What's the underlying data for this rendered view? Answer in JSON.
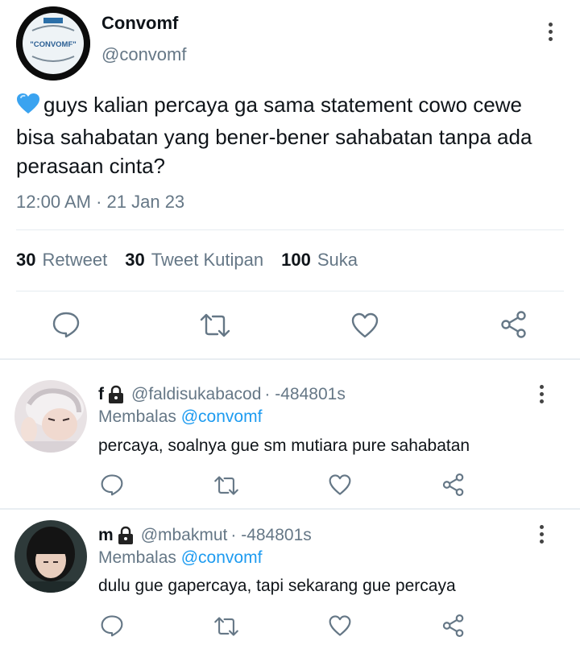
{
  "tweet": {
    "display_name": "Convomf",
    "handle": "@convomf",
    "avatar_text": "\"CONVOMF\"",
    "emoji": "blue-heart",
    "text": "guys kalian percaya ga sama statement cowo cewe bisa sahabatan yang bener-bener sahabatan tanpa ada perasaan cinta?",
    "time": "12:00 AM",
    "date_separator": "·",
    "date": "21 Jan 23",
    "stats": {
      "retweets_count": "30",
      "retweets_label": "Retweet",
      "quotes_count": "30",
      "quotes_label": "Tweet Kutipan",
      "likes_count": "100",
      "likes_label": "Suka"
    }
  },
  "replies": [
    {
      "name": "f",
      "handle": "@faldisukabacod",
      "time": "· -484801s",
      "replying_label": "Membalas",
      "replying_to": "@convomf",
      "text": "percaya, soalnya gue sm mutiara pure sahabatan"
    },
    {
      "name": "m",
      "handle": "@mbakmut",
      "time": "· -484801s",
      "replying_label": "Membalas",
      "replying_to": "@convomf",
      "text": "dulu gue gapercaya, tapi sekarang gue percaya"
    }
  ],
  "colors": {
    "accent": "#1d9bf0",
    "muted": "#657786",
    "text": "#0f1419",
    "divider": "#e6ecf0"
  },
  "icons": [
    "reply-icon",
    "retweet-icon",
    "like-icon",
    "share-icon",
    "more-icon",
    "lock-icon"
  ]
}
